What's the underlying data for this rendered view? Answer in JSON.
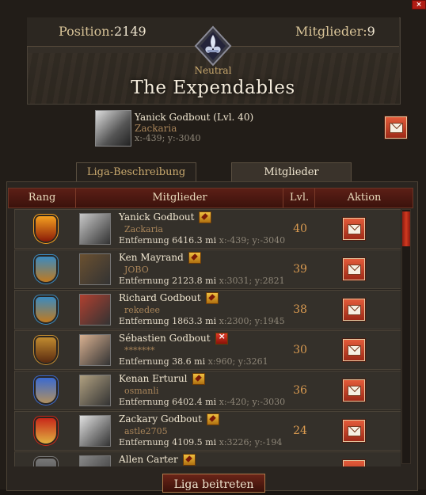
{
  "window": {
    "close_label": "×"
  },
  "guild": {
    "position_label": "Position:",
    "position_value": "2149",
    "members_label": "Mitglieder:",
    "members_value": "9",
    "status": "Neutral",
    "name": "The Expendables"
  },
  "leader": {
    "name": "Yanick Godbout (Lvl. 40)",
    "org": "Zackaria",
    "coords": "x:-439; y:-3040"
  },
  "tabs": [
    {
      "label": "Liga-Beschreibung"
    },
    {
      "label": "Mitglieder"
    }
  ],
  "table": {
    "headers": [
      "Rang",
      "Mitglieder",
      "Lvl.",
      "Aktion"
    ],
    "distance_label": "Entfernung",
    "rows": [
      {
        "name": "Yanick Godbout",
        "org": "Zackaria",
        "distance": "6416.3",
        "unit": "mi",
        "coords": "x:-439; y:-3040",
        "level": "40",
        "rank_icon": "flame-crown-rank-icon",
        "pin": "pin"
      },
      {
        "name": "Ken Mayrand",
        "org": "JOBO",
        "distance": "2123.8",
        "unit": "mi",
        "coords": "x:3031; y:2821",
        "level": "39",
        "rank_icon": "winged-helm-rank-icon",
        "pin": "pin"
      },
      {
        "name": "Richard Godbout",
        "org": "rekedee",
        "distance": "1863.3",
        "unit": "mi",
        "coords": "x:2300; y:1945",
        "level": "38",
        "rank_icon": "winged-helm-rank-icon",
        "pin": "pin"
      },
      {
        "name": "Sébastien Godbout",
        "org": "*******",
        "distance": "38.6",
        "unit": "mi",
        "coords": "x:960; y:3261",
        "level": "30",
        "rank_icon": "lion-crest-rank-icon",
        "pin": "remove"
      },
      {
        "name": "Kenan Erturul",
        "org": "osmanli",
        "distance": "6402.4",
        "unit": "mi",
        "coords": "x:-420; y:-3030",
        "level": "36",
        "rank_icon": "crossed-swords-rank-icon",
        "pin": "pin"
      },
      {
        "name": "Zackary Godbout",
        "org": "astle2705",
        "distance": "4109.5",
        "unit": "mi",
        "coords": "x:3226; y:-194",
        "level": "24",
        "rank_icon": "shield-rank-icon",
        "pin": "pin"
      },
      {
        "name": "Allen Carter",
        "org": "",
        "distance": "",
        "unit": "",
        "coords": "",
        "level": "",
        "rank_icon": "rank-icon",
        "pin": "pin"
      }
    ]
  },
  "join_button": {
    "label": "Liga beitreten"
  },
  "colors": {
    "accent_red": "#9e2a18",
    "gold": "#d99a50",
    "header_red": "#5c1f16"
  }
}
